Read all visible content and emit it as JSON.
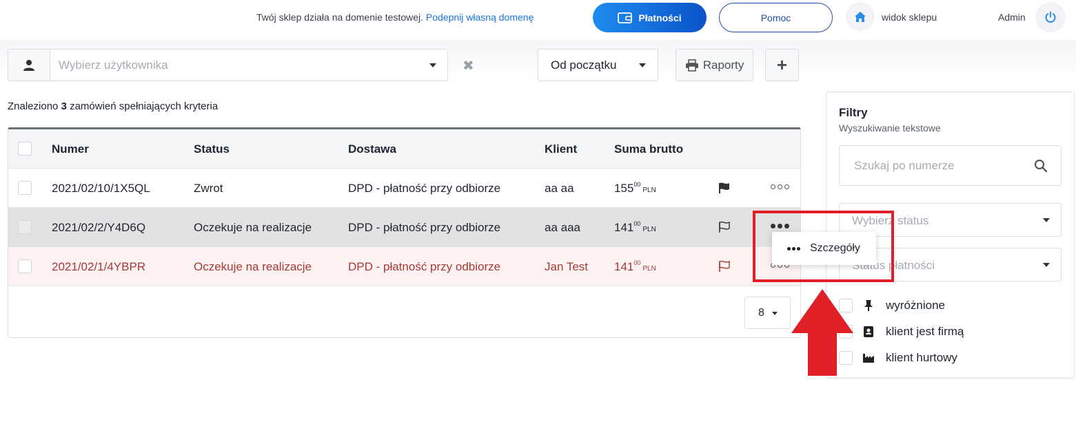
{
  "header": {
    "domain_note_text": "Twój sklep działa na domenie testowej.",
    "domain_note_link": "Podepnij własną domenę",
    "payments_label": "Płatności",
    "help_label": "Pomoc",
    "shop_view_label": "widok sklepu",
    "admin_label": "Admin"
  },
  "toolbar": {
    "user_placeholder": "Wybierz użytkownika",
    "clear_symbol": "✖",
    "period_value": "Od początku",
    "reports_label": "Raporty",
    "add_symbol": "+"
  },
  "results": {
    "prefix": "Znaleziono",
    "count": "3",
    "suffix": "zamówień spełniających kryteria"
  },
  "table": {
    "columns": [
      "Numer",
      "Status",
      "Dostawa",
      "Klient",
      "Suma brutto"
    ],
    "rows": [
      {
        "number": "2021/02/10/1X5QL",
        "status": "Zwrot",
        "delivery": "DPD - płatność przy odbiorze",
        "client": "aa aa",
        "price_int": "155",
        "price_dec": "00",
        "currency": "PLN",
        "flagged": true
      },
      {
        "number": "2021/02/2/Y4D6Q",
        "status": "Oczekuje na realizacje",
        "delivery": "DPD - płatność przy odbiorze",
        "client": "aa aaa",
        "price_int": "141",
        "price_dec": "00",
        "currency": "PLN",
        "flagged": false
      },
      {
        "number": "2021/02/1/4YBPR",
        "status": "Oczekuje na realizacje",
        "delivery": "DPD - płatność przy odbiorze",
        "client": "Jan Test",
        "price_int": "141",
        "price_dec": "00",
        "currency": "PLN",
        "flagged": false
      }
    ],
    "page_size": "8"
  },
  "context_menu": {
    "details_label": "Szczegóły"
  },
  "filters": {
    "title": "Filtry",
    "subtitle": "Wyszukiwanie tekstowe",
    "search_placeholder": "Szukaj po numerze",
    "status_placeholder": "Wybierz status",
    "payment_status_placeholder": "Status płatności",
    "checkboxes": [
      {
        "label": "wyróżnione",
        "icon": "pin-icon"
      },
      {
        "label": "klient jest firmą",
        "icon": "contact-card-icon"
      },
      {
        "label": "klient hurtowy",
        "icon": "factory-icon"
      }
    ]
  },
  "colors": {
    "accent": "#1a73d9",
    "annotation": "#e01f26",
    "row_highlight": "#e2e2e2",
    "row_alert_text": "#a33a35"
  }
}
